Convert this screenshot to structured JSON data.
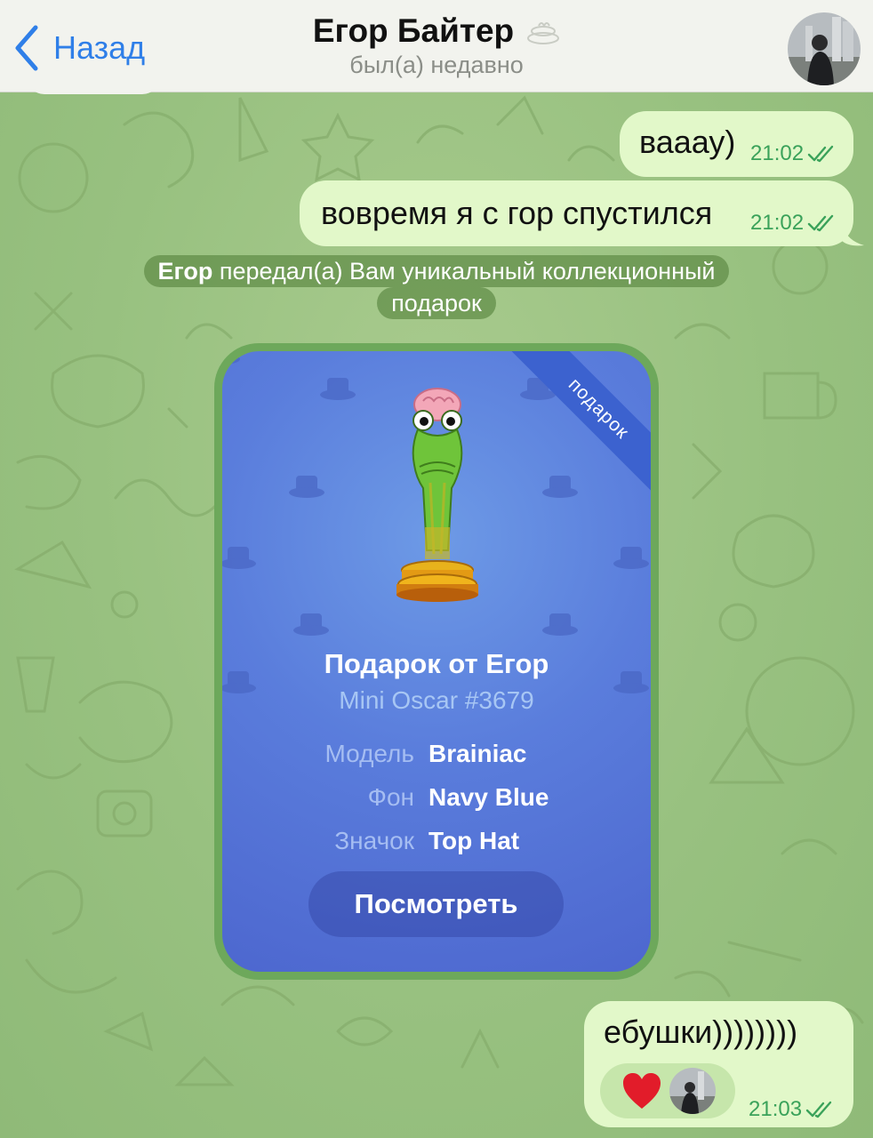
{
  "header": {
    "back_label": "Назад",
    "contact_name": "Егор Байтер",
    "status": "был(а) недавно"
  },
  "messages": [
    {
      "text": "вааау)",
      "time": "21:02"
    },
    {
      "text": "вовремя я с гор спустился",
      "time": "21:02"
    }
  ],
  "service": {
    "sender": "Егор",
    "line1_rest": " передал(а) Вам уникальный коллекционный",
    "line2": "подарок"
  },
  "gift": {
    "ribbon": "подарок",
    "title": "Подарок от Егор",
    "subtitle": "Mini Oscar #3679",
    "attributes": [
      {
        "label": "Модель",
        "value": "Brainiac"
      },
      {
        "label": "Фон",
        "value": "Navy Blue"
      },
      {
        "label": "Значок",
        "value": "Top Hat"
      }
    ],
    "button_label": "Посмотреть"
  },
  "last_message": {
    "text": "ебушки))))))))",
    "time": "21:03",
    "reaction": "heart"
  },
  "colors": {
    "accent": "#2f7fe8",
    "bubble": "#e2f8c9",
    "time": "#3aa25a",
    "card": "#5a7ddc",
    "chat_bg": "#98c180"
  }
}
